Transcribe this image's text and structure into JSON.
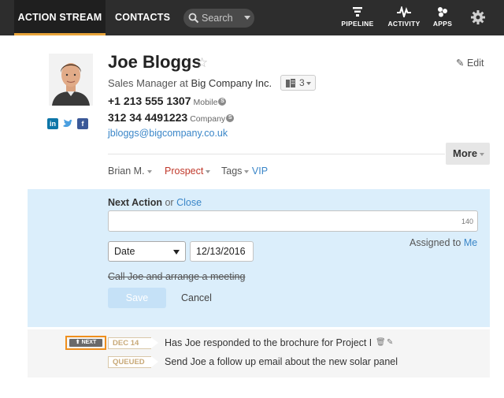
{
  "nav": {
    "tabs": [
      {
        "label": "ACTION STREAM",
        "active": true
      },
      {
        "label": "CONTACTS",
        "active": false
      }
    ],
    "search_placeholder": "Search",
    "icons": [
      {
        "label": "PIPELINE",
        "icon": "funnel-icon"
      },
      {
        "label": "ACTIVITY",
        "icon": "pulse-icon"
      },
      {
        "label": "APPS",
        "icon": "apps-icon"
      }
    ],
    "settings_icon": "gear-icon",
    "accent_color": "#e8a43a"
  },
  "contact": {
    "name": "Joe Bloggs",
    "title_prefix": "Sales Manager at",
    "company": "Big Company Inc.",
    "company_count": "3",
    "phones": [
      {
        "number": "+1 213 555 1307",
        "type": "Mobile"
      },
      {
        "number": "312 34 4491223",
        "type": "Company"
      }
    ],
    "email": "jbloggs@bigcompany.co.uk",
    "social": [
      "linkedin-icon",
      "twitter-icon",
      "facebook-icon"
    ],
    "edit_label": "Edit",
    "more_label": "More",
    "owner": "Brian M.",
    "status": "Prospect",
    "tags_label": "Tags",
    "tag": "VIP"
  },
  "next_action": {
    "title": "Next Action",
    "or": "or",
    "close": "Close",
    "char_count": "140",
    "assigned_label": "Assigned to",
    "assigned_value": "Me",
    "date_type": "Date",
    "date_value": "12/13/2016",
    "completed_text": "Call Joe and arrange a meeting",
    "save_label": "Save",
    "cancel_label": "Cancel"
  },
  "stream": {
    "next_tag": "NEXT",
    "items": [
      {
        "flag": "DEC 14",
        "text": "Has Joe responded to the brochure for Project B"
      },
      {
        "flag": "QUEUED",
        "text": "Send Joe a follow up email about the new solar panel ra"
      }
    ]
  }
}
